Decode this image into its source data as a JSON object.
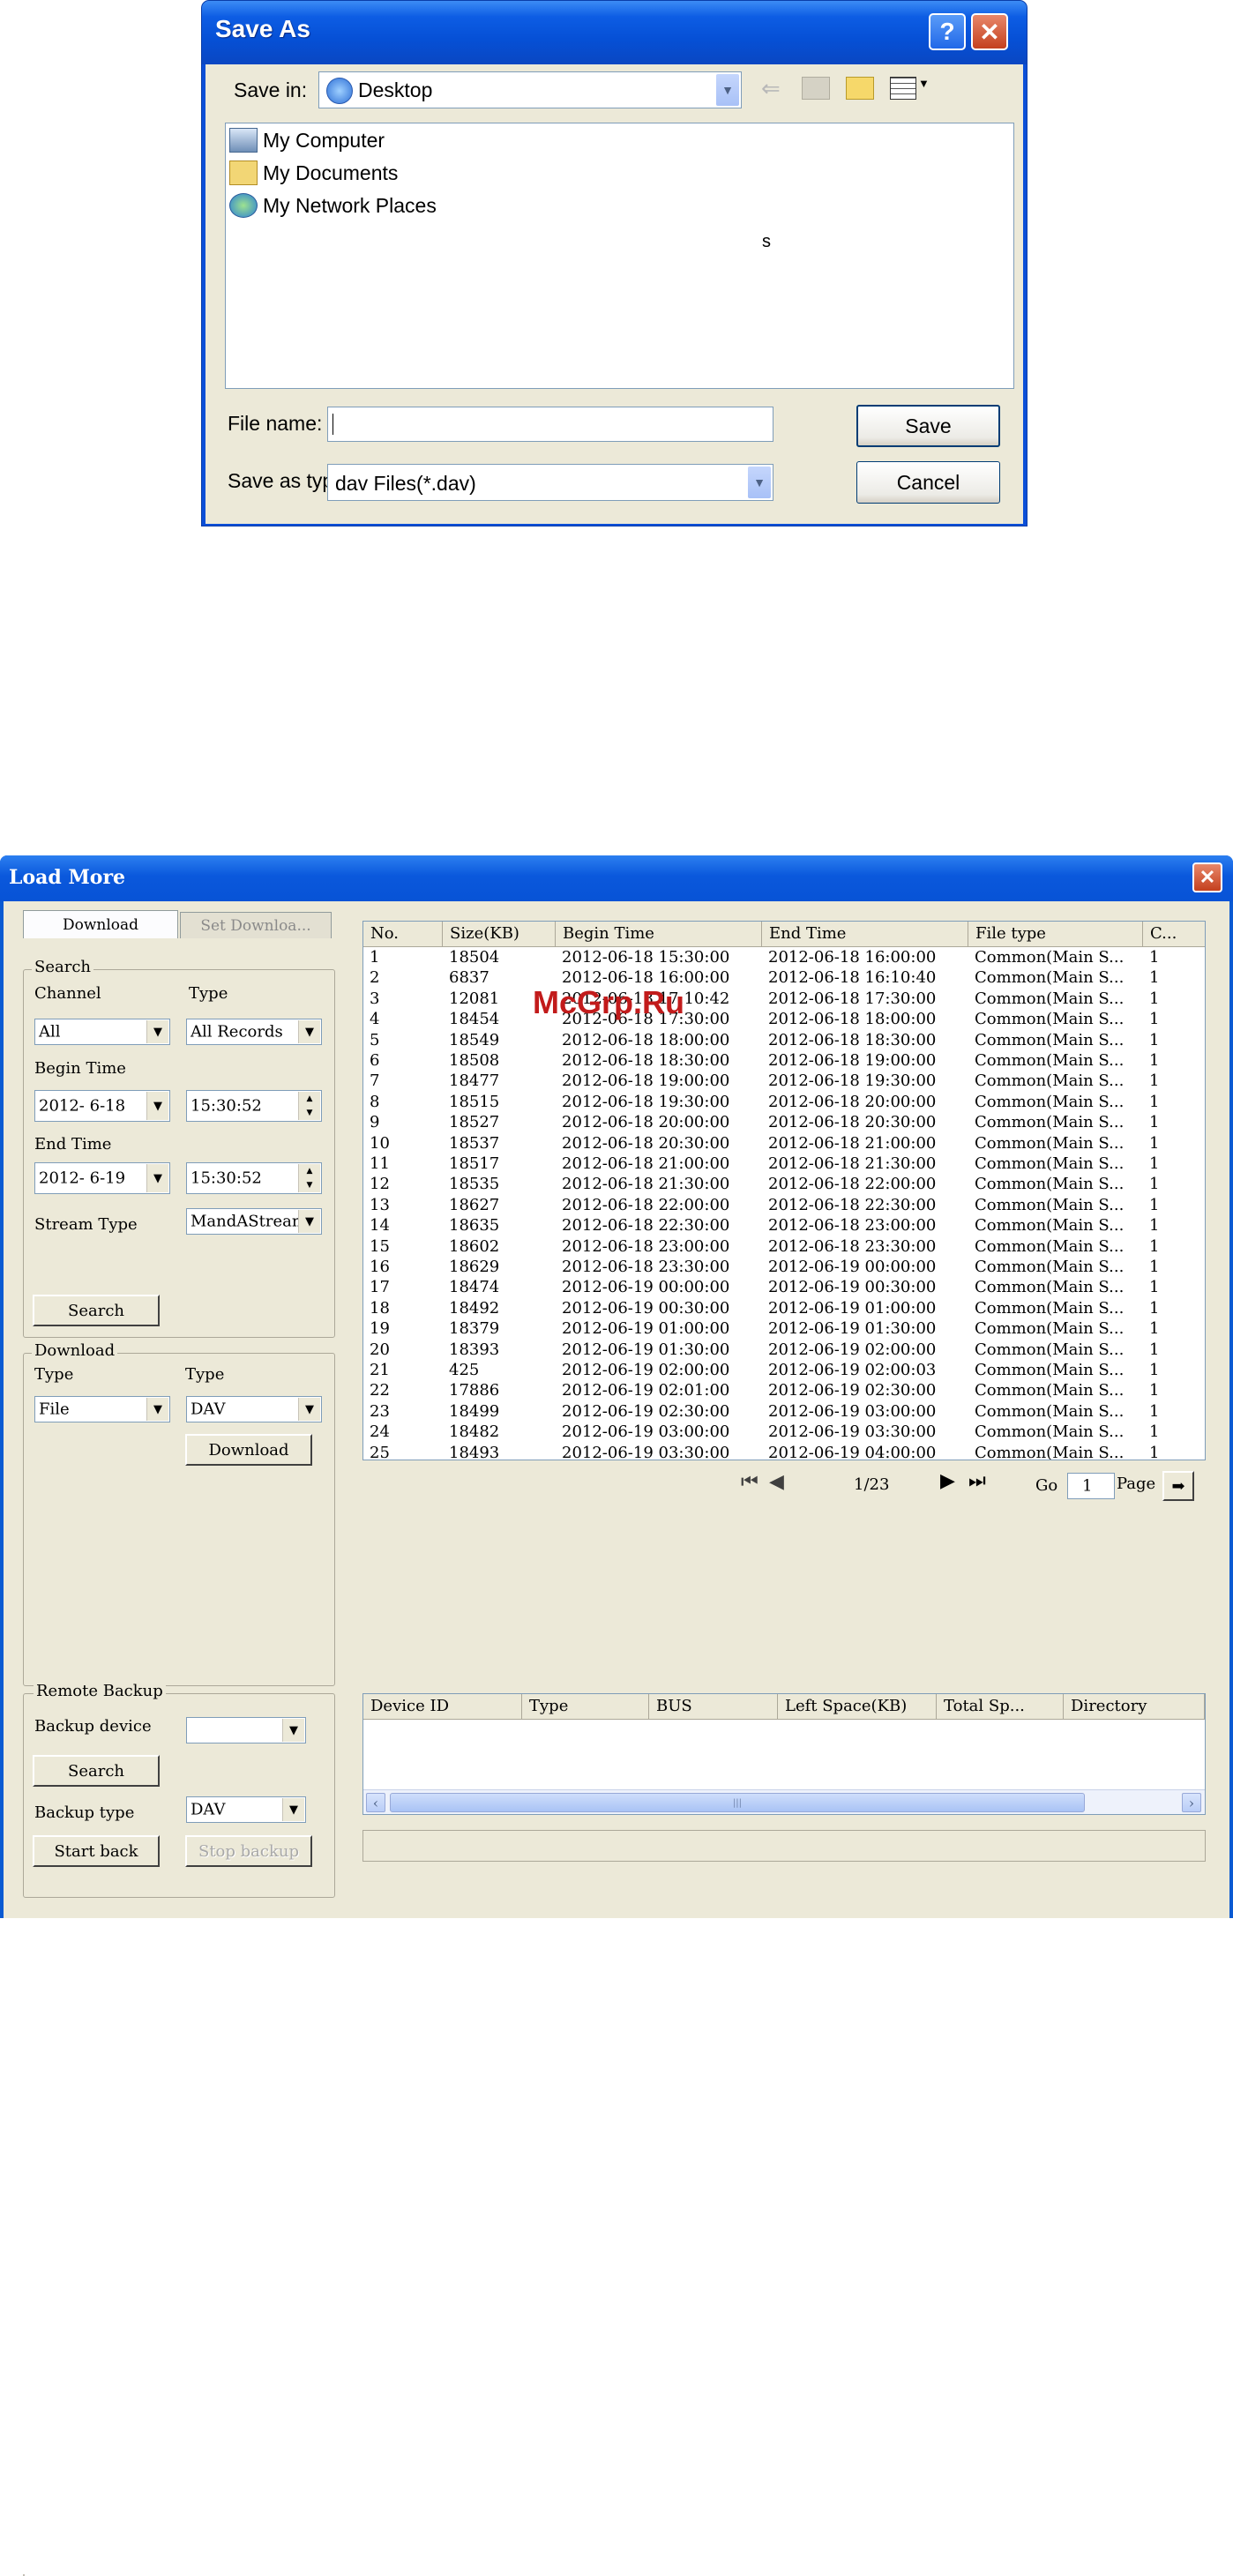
{
  "save_dialog": {
    "title": "Save As",
    "help_glyph": "?",
    "close_glyph": "✕",
    "save_in_label": "Save in:",
    "location": "Desktop",
    "items": [
      {
        "label": "My Computer",
        "icon": "computer-icon"
      },
      {
        "label": "My Documents",
        "icon": "folder-icon"
      },
      {
        "label": "My Network Places",
        "icon": "network-icon"
      }
    ],
    "stray_text": "s",
    "file_name_label": "File name:",
    "file_name_value": "",
    "save_type_label": "Save as type:",
    "save_type_value": "dav Files(*.dav)",
    "save_button": "Save",
    "cancel_button": "Cancel"
  },
  "load_more": {
    "title": "Load More",
    "close_glyph": "✕",
    "tabs": [
      "Download",
      "Set Downloa..."
    ],
    "search": {
      "legend": "Search",
      "channel_label": "Channel",
      "channel_value": "All",
      "type_label": "Type",
      "type_value": "All Records",
      "begin_label": "Begin Time",
      "begin_date": "2012- 6-18",
      "begin_time": "15:30:52",
      "end_label": "End Time",
      "end_date": "2012- 6-19",
      "end_time": "15:30:52",
      "stream_label": "Stream Type",
      "stream_value": "MandAStream",
      "search_button": "Search"
    },
    "download": {
      "legend": "Download",
      "type_label_1": "Type",
      "type_value_1": "File",
      "type_label_2": "Type",
      "type_value_2": "DAV",
      "download_button": "Download"
    },
    "remote_backup": {
      "legend": "Remote Backup",
      "device_label": "Backup device",
      "device_value": "",
      "search_button": "Search",
      "type_label": "Backup type",
      "type_value": "DAV",
      "start_button": "Start back",
      "stop_button": "Stop backup"
    },
    "file_table": {
      "columns": [
        "No.",
        "Size(KB)",
        "Begin Time",
        "End Time",
        "File type",
        "C..."
      ],
      "rows": [
        [
          "1",
          "18504",
          "2012-06-18 15:30:00",
          "2012-06-18 16:00:00",
          "Common(Main S...",
          "1"
        ],
        [
          "2",
          "6837",
          "2012-06-18 16:00:00",
          "2012-06-18 16:10:40",
          "Common(Main S...",
          "1"
        ],
        [
          "3",
          "12081",
          "2012-06-18 17:10:42",
          "2012-06-18 17:30:00",
          "Common(Main S...",
          "1"
        ],
        [
          "4",
          "18454",
          "2012-06-18 17:30:00",
          "2012-06-18 18:00:00",
          "Common(Main S...",
          "1"
        ],
        [
          "5",
          "18549",
          "2012-06-18 18:00:00",
          "2012-06-18 18:30:00",
          "Common(Main S...",
          "1"
        ],
        [
          "6",
          "18508",
          "2012-06-18 18:30:00",
          "2012-06-18 19:00:00",
          "Common(Main S...",
          "1"
        ],
        [
          "7",
          "18477",
          "2012-06-18 19:00:00",
          "2012-06-18 19:30:00",
          "Common(Main S...",
          "1"
        ],
        [
          "8",
          "18515",
          "2012-06-18 19:30:00",
          "2012-06-18 20:00:00",
          "Common(Main S...",
          "1"
        ],
        [
          "9",
          "18527",
          "2012-06-18 20:00:00",
          "2012-06-18 20:30:00",
          "Common(Main S...",
          "1"
        ],
        [
          "10",
          "18537",
          "2012-06-18 20:30:00",
          "2012-06-18 21:00:00",
          "Common(Main S...",
          "1"
        ],
        [
          "11",
          "18517",
          "2012-06-18 21:00:00",
          "2012-06-18 21:30:00",
          "Common(Main S...",
          "1"
        ],
        [
          "12",
          "18535",
          "2012-06-18 21:30:00",
          "2012-06-18 22:00:00",
          "Common(Main S...",
          "1"
        ],
        [
          "13",
          "18627",
          "2012-06-18 22:00:00",
          "2012-06-18 22:30:00",
          "Common(Main S...",
          "1"
        ],
        [
          "14",
          "18635",
          "2012-06-18 22:30:00",
          "2012-06-18 23:00:00",
          "Common(Main S...",
          "1"
        ],
        [
          "15",
          "18602",
          "2012-06-18 23:00:00",
          "2012-06-18 23:30:00",
          "Common(Main S...",
          "1"
        ],
        [
          "16",
          "18629",
          "2012-06-18 23:30:00",
          "2012-06-19 00:00:00",
          "Common(Main S...",
          "1"
        ],
        [
          "17",
          "18474",
          "2012-06-19 00:00:00",
          "2012-06-19 00:30:00",
          "Common(Main S...",
          "1"
        ],
        [
          "18",
          "18492",
          "2012-06-19 00:30:00",
          "2012-06-19 01:00:00",
          "Common(Main S...",
          "1"
        ],
        [
          "19",
          "18379",
          "2012-06-19 01:00:00",
          "2012-06-19 01:30:00",
          "Common(Main S...",
          "1"
        ],
        [
          "20",
          "18393",
          "2012-06-19 01:30:00",
          "2012-06-19 02:00:00",
          "Common(Main S...",
          "1"
        ],
        [
          "21",
          "425",
          "2012-06-19 02:00:00",
          "2012-06-19 02:00:03",
          "Common(Main S...",
          "1"
        ],
        [
          "22",
          "17886",
          "2012-06-19 02:01:00",
          "2012-06-19 02:30:00",
          "Common(Main S...",
          "1"
        ],
        [
          "23",
          "18499",
          "2012-06-19 02:30:00",
          "2012-06-19 03:00:00",
          "Common(Main S...",
          "1"
        ],
        [
          "24",
          "18482",
          "2012-06-19 03:00:00",
          "2012-06-19 03:30:00",
          "Common(Main S...",
          "1"
        ],
        [
          "25",
          "18493",
          "2012-06-19 03:30:00",
          "2012-06-19 04:00:00",
          "Common(Main S...",
          "1"
        ]
      ]
    },
    "watermark": "McGrp.Ru",
    "pager": {
      "page_text": "1/23",
      "go_label": "Go",
      "go_value": "1",
      "page_label": "Page"
    },
    "device_table": {
      "columns": [
        "Device ID",
        "Type",
        "BUS",
        "Left Space(KB)",
        "Total Sp...",
        "Directory"
      ]
    },
    "scroll_grip": "|||"
  }
}
